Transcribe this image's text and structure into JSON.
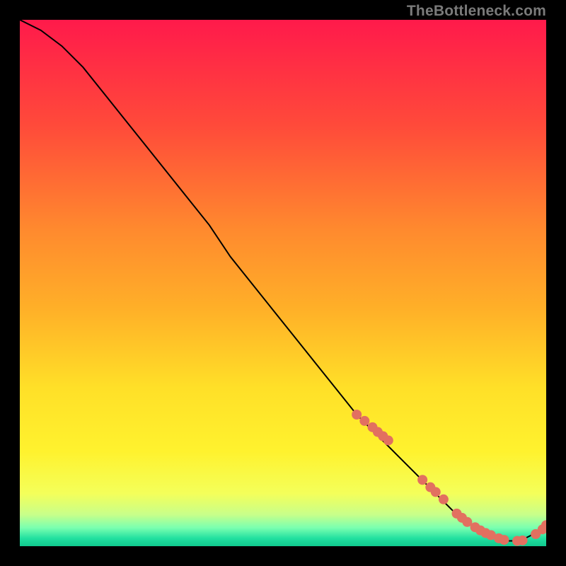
{
  "watermark": "TheBottleneck.com",
  "chart_data": {
    "type": "line",
    "title": "",
    "xlabel": "",
    "ylabel": "",
    "xlim": [
      0,
      100
    ],
    "ylim": [
      0,
      100
    ],
    "grid": false,
    "legend": false,
    "background": {
      "type": "vertical-gradient",
      "stops": [
        {
          "pos": 0.0,
          "color": "#ff1a4b"
        },
        {
          "pos": 0.2,
          "color": "#ff4a3a"
        },
        {
          "pos": 0.4,
          "color": "#ff8a2e"
        },
        {
          "pos": 0.55,
          "color": "#ffb028"
        },
        {
          "pos": 0.7,
          "color": "#ffe028"
        },
        {
          "pos": 0.82,
          "color": "#fff22e"
        },
        {
          "pos": 0.9,
          "color": "#f4ff5a"
        },
        {
          "pos": 0.94,
          "color": "#c8ff8a"
        },
        {
          "pos": 0.965,
          "color": "#7affb0"
        },
        {
          "pos": 0.985,
          "color": "#22e0a0"
        },
        {
          "pos": 1.0,
          "color": "#10c98e"
        }
      ]
    },
    "series": [
      {
        "name": "bottleneck-curve",
        "color": "#000000",
        "x": [
          0,
          4,
          8,
          12,
          16,
          20,
          24,
          28,
          32,
          36,
          40,
          44,
          48,
          52,
          56,
          60,
          64,
          68,
          72,
          76,
          80,
          83,
          86,
          89,
          92,
          95,
          97,
          100
        ],
        "y": [
          100,
          98,
          95,
          91,
          86,
          81,
          76,
          71,
          66,
          61,
          55,
          50,
          45,
          40,
          35,
          30,
          25,
          21,
          17,
          13,
          9,
          6,
          4,
          2,
          1,
          1,
          2,
          4
        ]
      }
    ],
    "markers": {
      "name": "highlight-dots",
      "color": "#e27060",
      "radius_px": 7,
      "x": [
        64,
        65.5,
        67,
        68,
        69,
        70,
        76.5,
        78,
        79,
        80.5,
        83,
        84,
        85,
        86.5,
        87.5,
        88.5,
        89.5,
        91,
        92,
        94.5,
        95.5,
        98,
        99.3,
        100
      ],
      "y": [
        25,
        23.8,
        22.6,
        21.7,
        20.9,
        20.1,
        12.6,
        11.2,
        10.3,
        8.9,
        6.2,
        5.4,
        4.6,
        3.6,
        3.0,
        2.5,
        2.1,
        1.5,
        1.2,
        1.0,
        1.1,
        2.3,
        3.2,
        4.0
      ]
    }
  }
}
